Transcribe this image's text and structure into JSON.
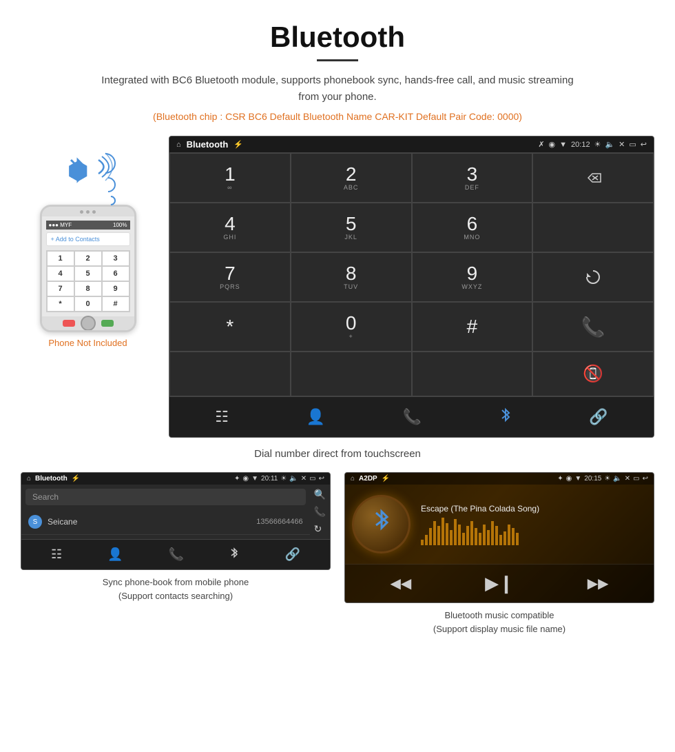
{
  "page": {
    "title": "Bluetooth",
    "subtitle": "Integrated with BC6 Bluetooth module, supports phonebook sync, hands-free call, and music streaming from your phone.",
    "chip_info": "(Bluetooth chip : CSR BC6    Default Bluetooth Name CAR-KIT    Default Pair Code: 0000)",
    "dial_caption": "Dial number direct from touchscreen",
    "phonebook_caption": "Sync phone-book from mobile phone\n(Support contacts searching)",
    "music_caption": "Bluetooth music compatible\n(Support display music file name)",
    "phone_not_included": "Phone Not Included"
  },
  "large_screen": {
    "status_title": "Bluetooth",
    "time": "20:12",
    "dialpad": {
      "keys": [
        {
          "digit": "1",
          "sub": ""
        },
        {
          "digit": "2",
          "sub": "ABC"
        },
        {
          "digit": "3",
          "sub": "DEF"
        },
        {
          "digit": "4",
          "sub": "GHI"
        },
        {
          "digit": "5",
          "sub": "JKL"
        },
        {
          "digit": "6",
          "sub": "MNO"
        },
        {
          "digit": "7",
          "sub": "PQRS"
        },
        {
          "digit": "8",
          "sub": "TUV"
        },
        {
          "digit": "9",
          "sub": "WXYZ"
        },
        {
          "digit": "*",
          "sub": ""
        },
        {
          "digit": "0",
          "sub": "+"
        },
        {
          "digit": "#",
          "sub": ""
        }
      ]
    }
  },
  "phonebook_screen": {
    "status_title": "Bluetooth",
    "time": "20:11",
    "search_placeholder": "Search",
    "contacts": [
      {
        "letter": "S",
        "name": "Seicane",
        "phone": "13566664466"
      }
    ]
  },
  "music_screen": {
    "status_title": "A2DP",
    "time": "20:15",
    "song_title": "Escape (The Pina Colada Song)",
    "visualizer_bars": [
      8,
      15,
      25,
      35,
      28,
      40,
      32,
      22,
      38,
      30,
      18,
      28,
      35,
      25,
      18,
      30,
      22,
      35,
      28,
      15,
      20,
      30,
      25,
      18
    ]
  },
  "phone_keys": [
    "1",
    "2",
    "3",
    "4",
    "5",
    "6",
    "7",
    "8",
    "9",
    "*",
    "0",
    "#"
  ]
}
